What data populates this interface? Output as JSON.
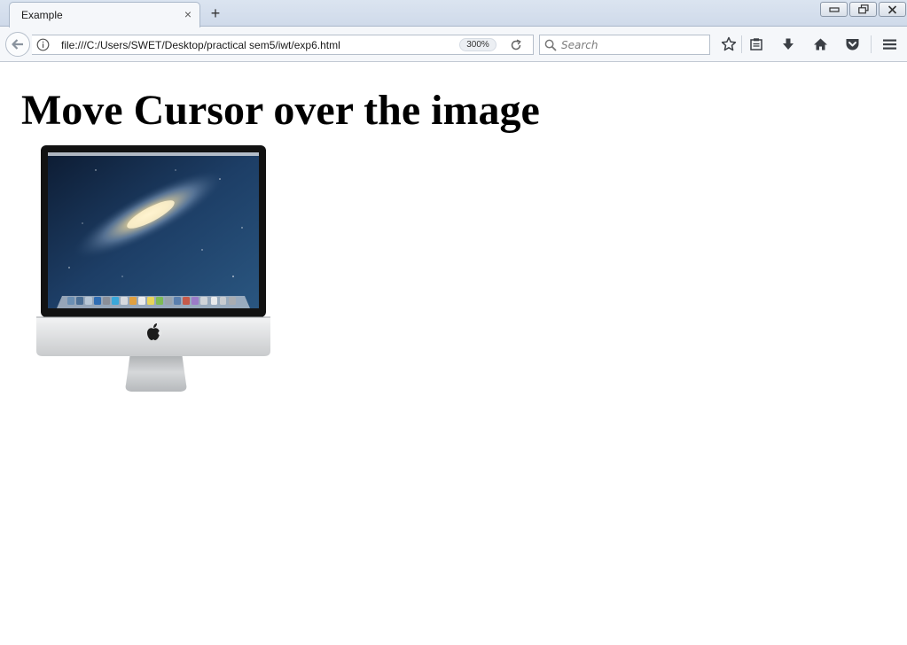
{
  "browser": {
    "tab": {
      "title": "Example",
      "close_glyph": "×"
    },
    "new_tab_glyph": "+",
    "url": "file:///C:/Users/SWET/Desktop/practical sem5/iwt/exp6.html",
    "zoom": "300%",
    "search": {
      "placeholder": "Search",
      "value": ""
    },
    "icons": [
      "back-arrow-icon",
      "info-icon",
      "reload-icon",
      "search-icon",
      "star-icon",
      "reader-view-icon",
      "download-icon",
      "home-icon",
      "pocket-icon",
      "hamburger-menu-icon",
      "minimize-icon",
      "restore-icon",
      "close-window-icon"
    ]
  },
  "page": {
    "heading": "Move Cursor over the image",
    "image": {
      "alt": "iMac computer",
      "apple_logo": ""
    }
  },
  "colors": {
    "tabstrip": "#cfdaea",
    "toolbar": "#f5f7fa",
    "icon": "#3b3f45",
    "text": "#000000"
  }
}
